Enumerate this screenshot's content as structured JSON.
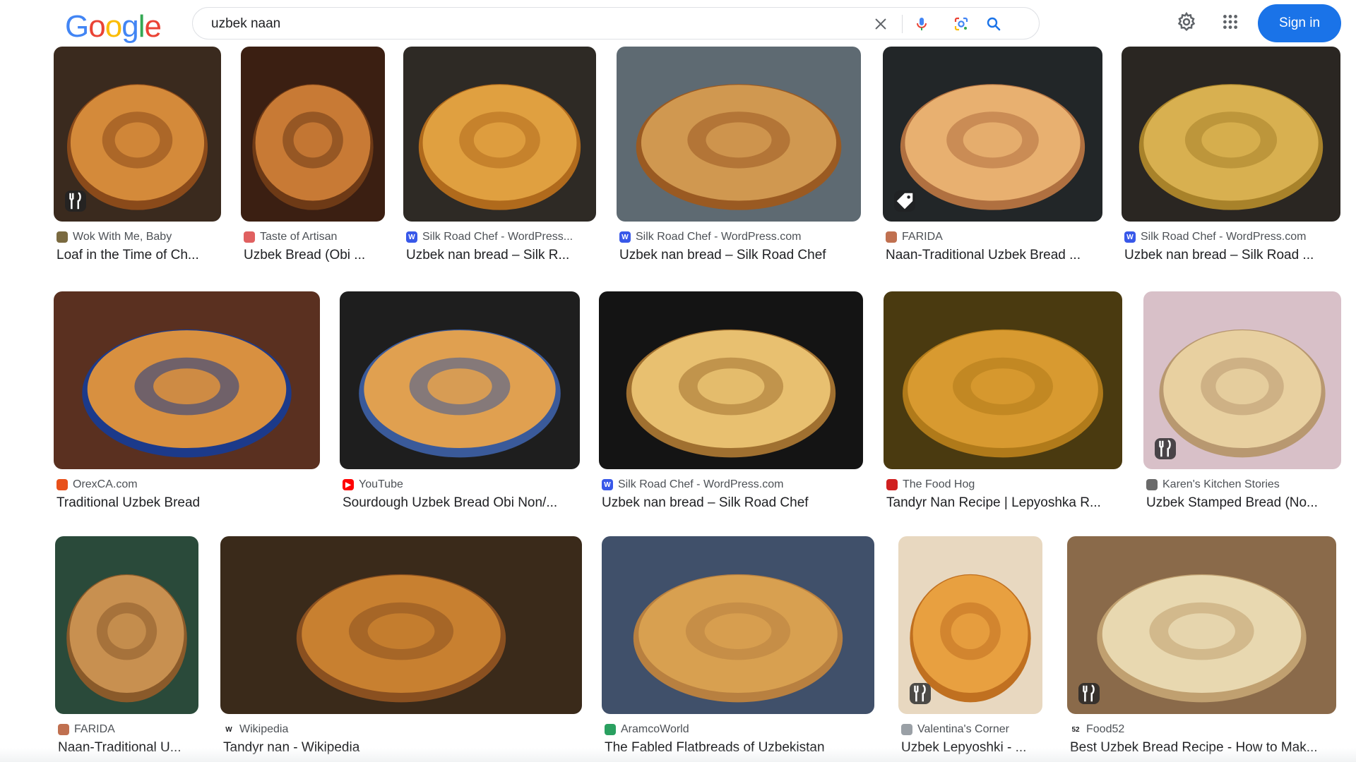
{
  "logo": {
    "text": "Google",
    "letters": [
      "G",
      "o",
      "o",
      "g",
      "l",
      "e"
    ],
    "colors": [
      "#4285F4",
      "#EA4335",
      "#FBBC05",
      "#4285F4",
      "#34A853",
      "#EA4335"
    ]
  },
  "search": {
    "query": "uzbek naan",
    "placeholder": ""
  },
  "header": {
    "signin_label": "Sign in"
  },
  "colors": {
    "accent": "#1a73e8",
    "mic_blue": "#4285F4"
  },
  "results": [
    {
      "source": "Wok With Me, Baby",
      "title": "Loaf in the Time of Ch...",
      "favicon": "photo-favicon",
      "badge": "recipe-icon"
    },
    {
      "source": "Taste of Artisan",
      "title": "Uzbek Bread (Obi ...",
      "favicon": "artisan-favicon",
      "badge": ""
    },
    {
      "source": "Silk Road Chef - WordPress...",
      "title": "Uzbek nan bread – Silk R...",
      "favicon": "wordpress-favicon",
      "badge": ""
    },
    {
      "source": "Silk Road Chef - WordPress.com",
      "title": "Uzbek nan bread – Silk Road Chef",
      "favicon": "wordpress-favicon",
      "badge": ""
    },
    {
      "source": "FARIDA",
      "title": "Naan-Traditional Uzbek Bread ...",
      "favicon": "farida-favicon",
      "badge": "tag-icon"
    },
    {
      "source": "Silk Road Chef - WordPress.com",
      "title": "Uzbek nan bread – Silk Road ...",
      "favicon": "wordpress-favicon",
      "badge": ""
    },
    {
      "source": "OrexCA.com",
      "title": "Traditional Uzbek Bread",
      "favicon": "orexca-favicon",
      "badge": ""
    },
    {
      "source": "YouTube",
      "title": "Sourdough Uzbek Bread Obi Non/...",
      "favicon": "youtube-favicon",
      "badge": ""
    },
    {
      "source": "Silk Road Chef - WordPress.com",
      "title": "Uzbek nan bread – Silk Road Chef",
      "favicon": "wordpress-favicon",
      "badge": ""
    },
    {
      "source": "The Food Hog",
      "title": "Tandyr Nan Recipe | Lepyoshka R...",
      "favicon": "foodhog-favicon",
      "badge": ""
    },
    {
      "source": "Karen's Kitchen Stories",
      "title": "Uzbek Stamped Bread (No...",
      "favicon": "kitchen-favicon",
      "badge": "recipe-icon"
    },
    {
      "source": "FARIDA",
      "title": "Naan-Traditional U...",
      "favicon": "farida-favicon",
      "badge": ""
    },
    {
      "source": "Wikipedia",
      "title": "Tandyr nan - Wikipedia",
      "favicon": "wikipedia-favicon",
      "badge": ""
    },
    {
      "source": "AramcoWorld",
      "title": "The Fabled Flatbreads of Uzbekistan",
      "favicon": "aramco-favicon",
      "badge": ""
    },
    {
      "source": "Valentina's Corner",
      "title": "Uzbek Lepyoshki - ...",
      "favicon": "valentina-favicon",
      "badge": "recipe-icon"
    },
    {
      "source": "Food52",
      "title": "Best Uzbek Bread Recipe - How to Mak...",
      "favicon": "food52-favicon",
      "badge": "recipe-icon"
    }
  ]
}
